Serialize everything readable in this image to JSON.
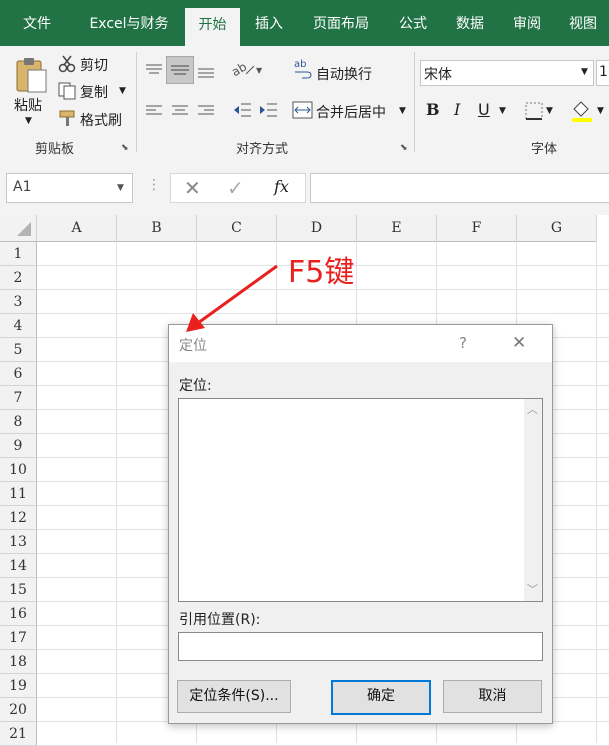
{
  "ribbon_tabs": [
    "文件",
    "Excel与财务",
    "开始",
    "插入",
    "页面布局",
    "公式",
    "数据",
    "审阅",
    "视图"
  ],
  "clipboard": {
    "paste": "粘贴",
    "cut": "剪切",
    "copy": "复制",
    "format_painter": "格式刷",
    "group_label": "剪贴板"
  },
  "alignment": {
    "wrap_text": "自动换行",
    "merge_center": "合并后居中",
    "group_label": "对齐方式"
  },
  "font": {
    "font_name": "宋体",
    "font_size_partial": "1",
    "bold": "B",
    "italic": "I",
    "underline": "U",
    "group_label": "字体"
  },
  "formula_bar": {
    "name_box": "A1",
    "fx": "fx",
    "value": ""
  },
  "grid": {
    "columns": [
      "A",
      "B",
      "C",
      "D",
      "E",
      "F",
      "G"
    ],
    "rows": [
      "1",
      "2",
      "3",
      "4",
      "5",
      "6",
      "7",
      "8",
      "9",
      "10",
      "11",
      "12",
      "13",
      "14",
      "15",
      "16",
      "17",
      "18",
      "19",
      "20",
      "21"
    ]
  },
  "annotation": {
    "text": "F5键",
    "color": "#e8211f"
  },
  "dialog": {
    "title": "定位",
    "help": "?",
    "goto_label": "定位:",
    "reference_label": "引用位置(R):",
    "reference_value": "",
    "special_button": "定位条件(S)...",
    "ok_button": "确定",
    "cancel_button": "取消"
  },
  "colors": {
    "excel_green": "#217346",
    "focus_blue": "#0078d7"
  }
}
